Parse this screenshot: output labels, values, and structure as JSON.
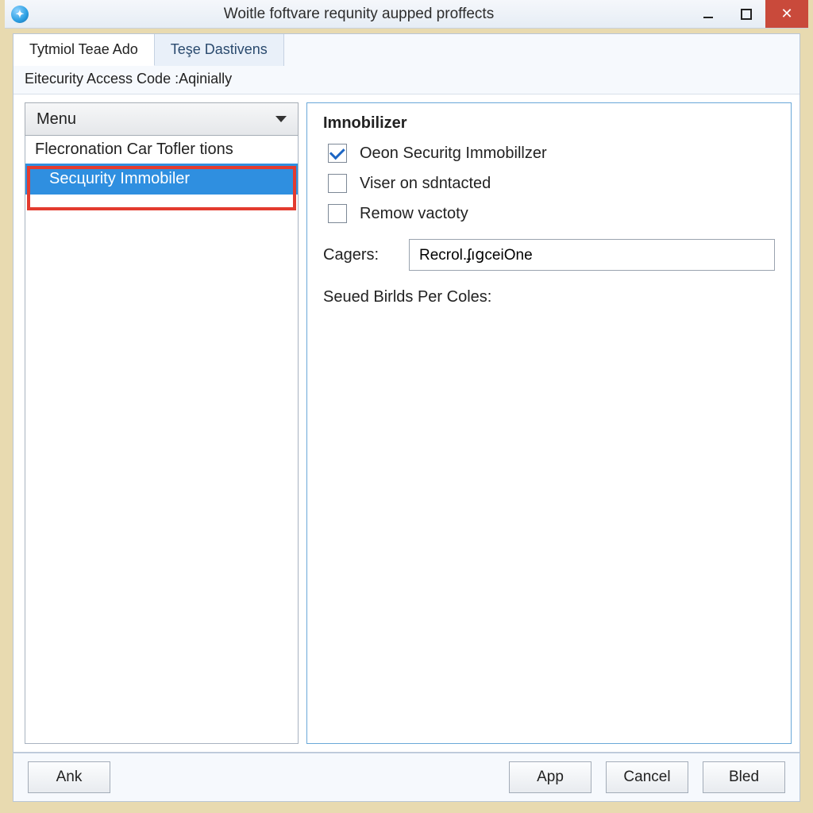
{
  "window": {
    "title": "Woitle foftvare requnity aupped proffects"
  },
  "tabs": [
    {
      "label": "Tytmiol Teae Ado",
      "active": true
    },
    {
      "label": "Teşe Dastivens",
      "active": false
    }
  ],
  "subheader": "Eitecurity Access Code :Aqinially",
  "menu": {
    "label": "Menu"
  },
  "tree": {
    "items": [
      {
        "label": "Flecronation Car Tofler tions",
        "selected": false
      },
      {
        "label": "Secцurity Immobiler",
        "selected": true,
        "highlighted": true
      }
    ]
  },
  "details": {
    "title": "Imnobilizer",
    "checkboxes": [
      {
        "label": "Oeon Securitg Immobillzer",
        "checked": true
      },
      {
        "label": "Viser on sdntacted",
        "checked": false
      },
      {
        "label": "Remow vactoty",
        "checked": false
      }
    ],
    "cagers_label": "Cagers:",
    "cagers_value": "Recrol.ʄıցceiOne",
    "seued_label": "Seued Birlds Per Coles:"
  },
  "footer": {
    "buttons": {
      "ank": "Ank",
      "app": "App",
      "cancel": "Cancel",
      "bled": "Bled"
    }
  }
}
